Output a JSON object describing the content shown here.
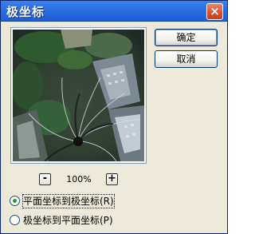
{
  "dialog": {
    "title": "极坐标",
    "close_glyph": "×"
  },
  "buttons": {
    "ok_label": "确定",
    "cancel_label": "取消"
  },
  "zoom": {
    "minus_label": "-",
    "value": "100%",
    "plus_label": "+"
  },
  "options": [
    {
      "label": "平面坐标到极坐标(R)",
      "selected": true
    },
    {
      "label": "极坐标到平面坐标(P)",
      "selected": false
    }
  ],
  "colors": {
    "titlebar": "#2b6fe0",
    "window_bg": "#ece9d8",
    "close_button": "#d9532f",
    "radio_dot": "#21a121"
  }
}
